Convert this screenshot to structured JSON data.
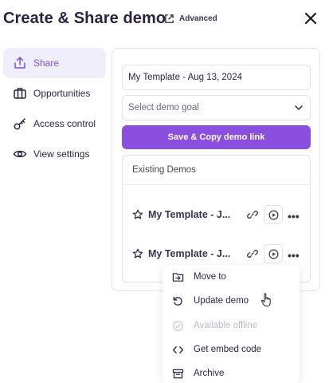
{
  "header": {
    "title": "Create & Share demo",
    "advanced_label": "Advanced"
  },
  "sidebar": {
    "items": [
      {
        "label": "Share",
        "icon": "share-upload-icon",
        "active": true
      },
      {
        "label": "Opportunities",
        "icon": "briefcase-icon",
        "active": false
      },
      {
        "label": "Access control",
        "icon": "key-icon",
        "active": false
      },
      {
        "label": "View settings",
        "icon": "eye-icon",
        "active": false
      }
    ]
  },
  "share": {
    "template_name_value": "My Template - Aug 13, 2024",
    "demo_goal_placeholder": "Select demo goal",
    "save_copy_label": "Save & Copy demo link",
    "existing_demos_title": "Existing Demos",
    "demos": [
      {
        "title": "My Template - J..."
      },
      {
        "title": "My Template - J..."
      }
    ]
  },
  "context_menu": {
    "items": [
      {
        "label": "Move to",
        "icon": "move-to-folder-icon",
        "disabled": false
      },
      {
        "label": "Update demo",
        "icon": "refresh-icon",
        "disabled": false
      },
      {
        "label": "Available offline",
        "icon": "check-circle-icon",
        "disabled": true
      },
      {
        "label": "Get embed code",
        "icon": "code-icon",
        "disabled": false
      },
      {
        "label": "Archive",
        "icon": "archive-icon",
        "disabled": false
      }
    ]
  },
  "colors": {
    "accent": "#8b4fe0",
    "active_nav_bg": "#f1eefc",
    "text": "#2b2342"
  }
}
